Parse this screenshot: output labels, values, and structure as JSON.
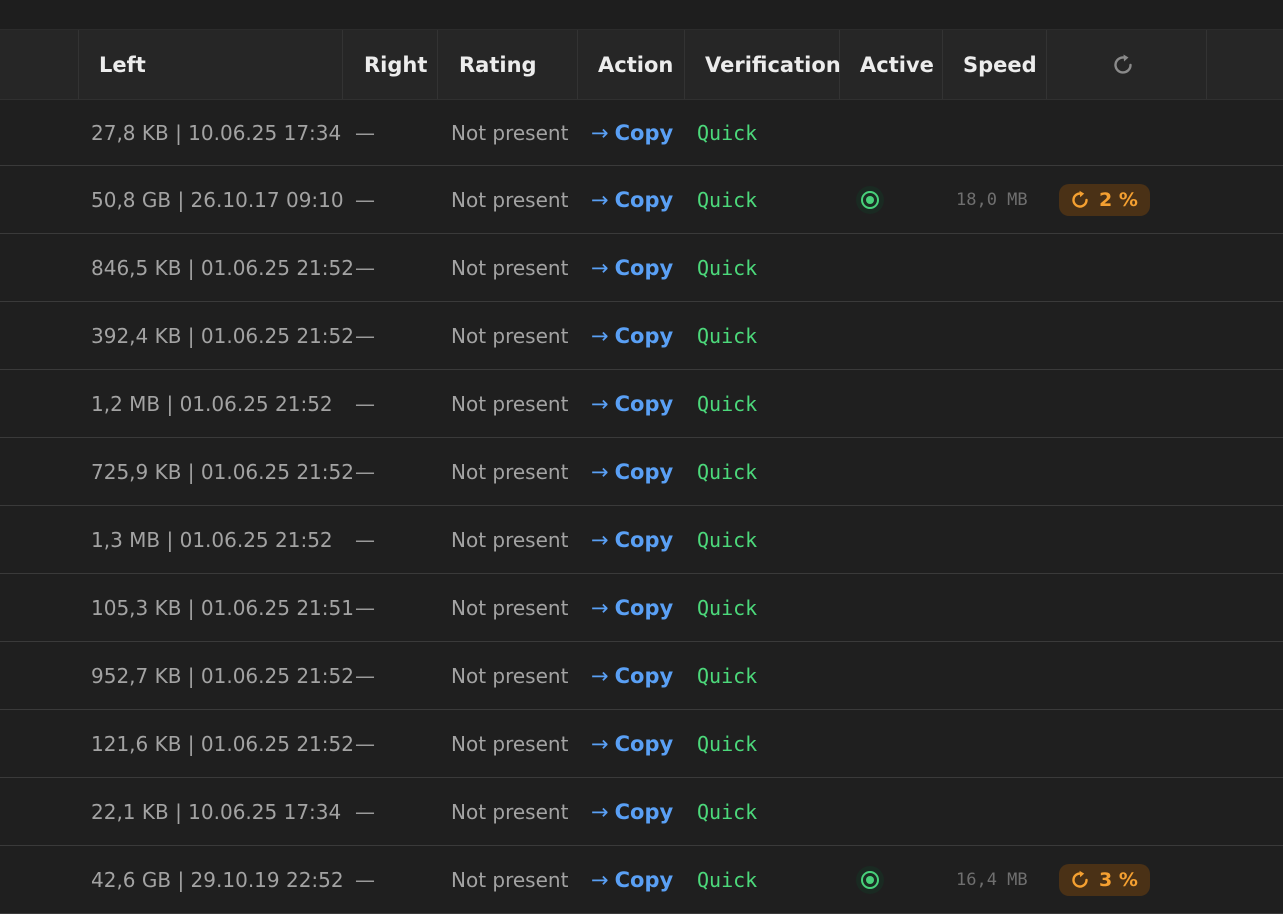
{
  "table": {
    "headers": {
      "left": "Left",
      "right": "Right",
      "rating": "Rating",
      "action": "Action",
      "verification": "Verification",
      "active": "Active",
      "speed": "Speed"
    },
    "rows": [
      {
        "left": "27,8 KB | 10.06.25 17:34",
        "right": "—",
        "rating": "Not present",
        "action": "Copy",
        "verification": "Quick"
      },
      {
        "left": "50,8 GB | 26.10.17 09:10",
        "right": "—",
        "rating": "Not present",
        "action": "Copy",
        "verification": "Quick",
        "active": true,
        "speed": "18,0 MB",
        "progress": "2 %"
      },
      {
        "left": "846,5 KB | 01.06.25 21:52",
        "right": "—",
        "rating": "Not present",
        "action": "Copy",
        "verification": "Quick"
      },
      {
        "left": "392,4 KB | 01.06.25 21:52",
        "right": "—",
        "rating": "Not present",
        "action": "Copy",
        "verification": "Quick"
      },
      {
        "left": "1,2 MB | 01.06.25 21:52",
        "right": "—",
        "rating": "Not present",
        "action": "Copy",
        "verification": "Quick"
      },
      {
        "left": "725,9 KB | 01.06.25 21:52",
        "right": "—",
        "rating": "Not present",
        "action": "Copy",
        "verification": "Quick"
      },
      {
        "left": "1,3 MB | 01.06.25 21:52",
        "right": "—",
        "rating": "Not present",
        "action": "Copy",
        "verification": "Quick"
      },
      {
        "left": "105,3 KB | 01.06.25 21:51",
        "right": "—",
        "rating": "Not present",
        "action": "Copy",
        "verification": "Quick"
      },
      {
        "left": "952,7 KB | 01.06.25 21:52",
        "right": "—",
        "rating": "Not present",
        "action": "Copy",
        "verification": "Quick"
      },
      {
        "left": "121,6 KB | 01.06.25 21:52",
        "right": "—",
        "rating": "Not present",
        "action": "Copy",
        "verification": "Quick"
      },
      {
        "left": "22,1 KB | 10.06.25 17:34",
        "right": "—",
        "rating": "Not present",
        "action": "Copy",
        "verification": "Quick"
      },
      {
        "left": "42,6 GB | 29.10.19 22:52",
        "right": "—",
        "rating": "Not present",
        "action": "Copy",
        "verification": "Quick",
        "active": true,
        "speed": "16,4 MB",
        "progress": "3 %"
      }
    ]
  },
  "icons": {
    "refresh": "refresh-icon",
    "action_arrow": "arrow-right-icon",
    "active_indicator": "radio-dot-icon",
    "progress": "progress-circle-icon"
  },
  "colors": {
    "action": "#5aa0f5",
    "verification": "#4cd97b",
    "active": "#48d07a",
    "progress": "#f5a031"
  }
}
